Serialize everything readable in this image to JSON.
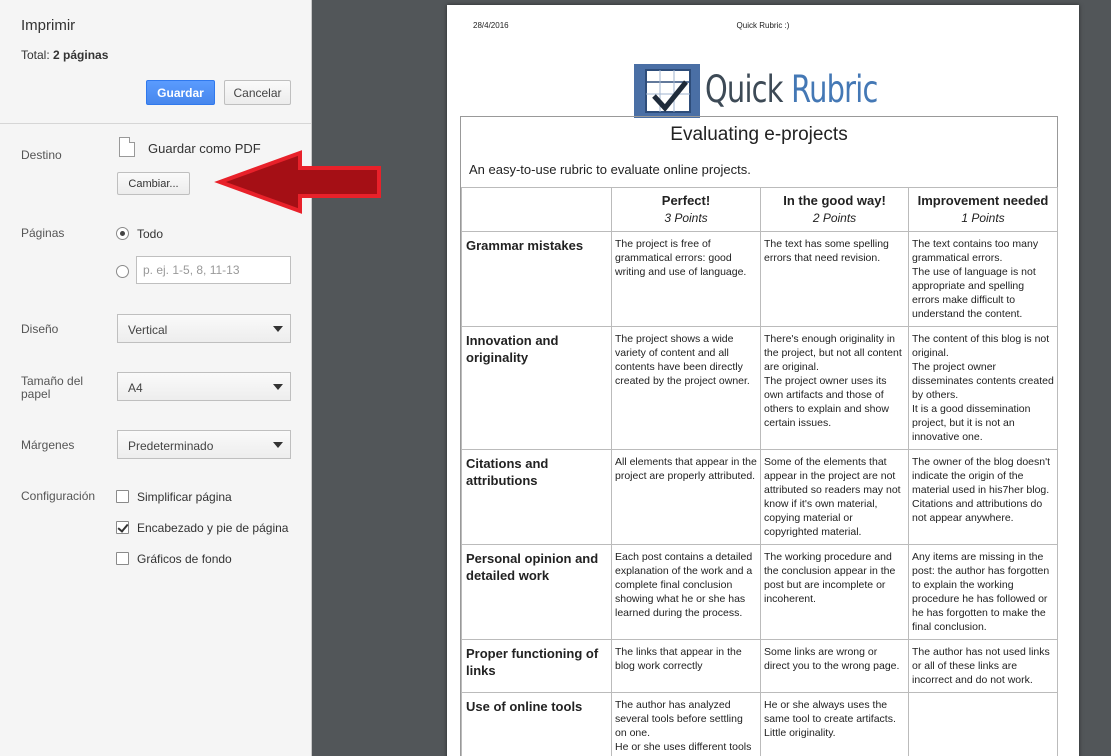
{
  "panel": {
    "title": "Imprimir",
    "total_label": "Total: ",
    "total_value": "2 páginas",
    "save_label": "Guardar",
    "cancel_label": "Cancelar",
    "destination": {
      "label": "Destino",
      "value": "Guardar como PDF",
      "change_label": "Cambiar..."
    },
    "pages": {
      "label": "Páginas",
      "all_label": "Todo",
      "all_selected": true,
      "range_placeholder": "p. ej. 1-5, 8, 11-13"
    },
    "layout": {
      "label": "Diseño",
      "value": "Vertical"
    },
    "paper_size": {
      "label": "Tamaño del papel",
      "value": "A4"
    },
    "margins": {
      "label": "Márgenes",
      "value": "Predeterminado"
    },
    "options": {
      "label": "Configuración",
      "items": [
        {
          "label": "Simplificar página",
          "checked": false
        },
        {
          "label": "Encabezado y pie de página",
          "checked": true
        },
        {
          "label": "Gráficos de fondo",
          "checked": false
        }
      ]
    },
    "accent_color": "#4d90fe"
  },
  "annotation": {
    "arrow_color": "#a50f15",
    "arrow_outline": "#e8212a"
  },
  "preview": {
    "header_date": "28/4/2016",
    "header_title": "Quick Rubric :)",
    "logo": {
      "word1": "Quick",
      "word2": "Rubric"
    },
    "rubric": {
      "title": "Evaluating e-projects",
      "description": "An easy-to-use rubric to evaluate online projects.",
      "levels": [
        {
          "name": "Perfect!",
          "points": "3 Points"
        },
        {
          "name": "In the good way!",
          "points": "2 Points"
        },
        {
          "name": "Improvement needed",
          "points": "1 Points"
        }
      ],
      "rows": [
        {
          "criterion": "Grammar mistakes",
          "cells": [
            "The project is free of grammatical errors: good writing and use of language.",
            "The text has some spelling errors that need revision.",
            "The text contains too many grammatical errors.\nThe use of language is not appropriate and spelling errors make difficult to understand the content."
          ]
        },
        {
          "criterion": "Innovation and originality",
          "cells": [
            "The project shows a wide variety of content and all contents have been directly created by the project owner.",
            "There's enough originality in the project, but not all content are original.\nThe project owner uses its own artifacts and those of others to explain and show certain issues.",
            "The content of this blog is not original.\nThe project owner disseminates contents created by others.\nIt is a good dissemination project, but it is not an innovative one."
          ]
        },
        {
          "criterion": "Citations and attributions",
          "cells": [
            "All elements that appear in the project are properly attributed.",
            "Some of the elements that appear in the project are not attributed so readers may not know if it's own material, copying material or copyrighted material.",
            "The owner of the blog doesn't indicate the origin of the material used in his7her blog. Citations and attributions do not appear anywhere."
          ]
        },
        {
          "criterion": "Personal opinion and detailed work",
          "cells": [
            "Each post contains a detailed explanation of the work and a complete final conclusion showing what he or she has learned during the process.",
            "The working procedure and the conclusion appear in the post but are incomplete or incoherent.",
            "Any items are missing in the post: the author has forgotten to explain the working procedure he has followed or he has forgotten to make the final conclusion."
          ]
        },
        {
          "criterion": "Proper functioning of links",
          "cells": [
            "The links that appear in the blog work correctly",
            "Some links are wrong or direct you to the wrong page.",
            "The author has not used links or all of these links are incorrect and do not work."
          ]
        },
        {
          "criterion": "Use of online tools",
          "cells": [
            "The author has analyzed several tools before settling on one.\nHe or she uses different tools for each task.",
            "He or she always uses the same tool to create artifacts.\nLittle originality.",
            ""
          ]
        }
      ]
    }
  }
}
